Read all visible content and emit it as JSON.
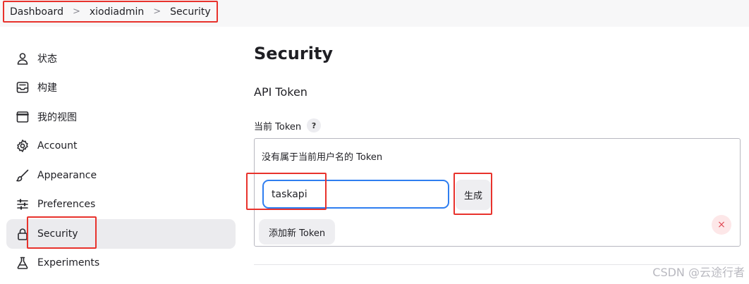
{
  "breadcrumb": {
    "items": [
      "Dashboard",
      "xiodiadmin",
      "Security"
    ],
    "separator": ">"
  },
  "sidebar": {
    "items": [
      {
        "label": "状态",
        "icon": "user-icon"
      },
      {
        "label": "构建",
        "icon": "inbox-icon"
      },
      {
        "label": "我的视图",
        "icon": "window-icon"
      },
      {
        "label": "Account",
        "icon": "gear-icon"
      },
      {
        "label": "Appearance",
        "icon": "brush-icon"
      },
      {
        "label": "Preferences",
        "icon": "sliders-icon"
      },
      {
        "label": "Security",
        "icon": "lock-icon",
        "active": true
      },
      {
        "label": "Experiments",
        "icon": "flask-icon"
      }
    ]
  },
  "main": {
    "title": "Security",
    "section_title": "API Token",
    "field_label": "当前 Token",
    "help_label": "?",
    "no_token_text": "没有属于当前用户名的 Token",
    "token_input_value": "taskapi",
    "generate_label": "生成",
    "remove_label": "×",
    "add_token_label": "添加新 Token"
  },
  "watermark": "CSDN @云途行者",
  "colors": {
    "annotation_red": "#e8322c",
    "input_focus_blue": "#2f7ef0",
    "active_item_bg": "#ebebee"
  }
}
